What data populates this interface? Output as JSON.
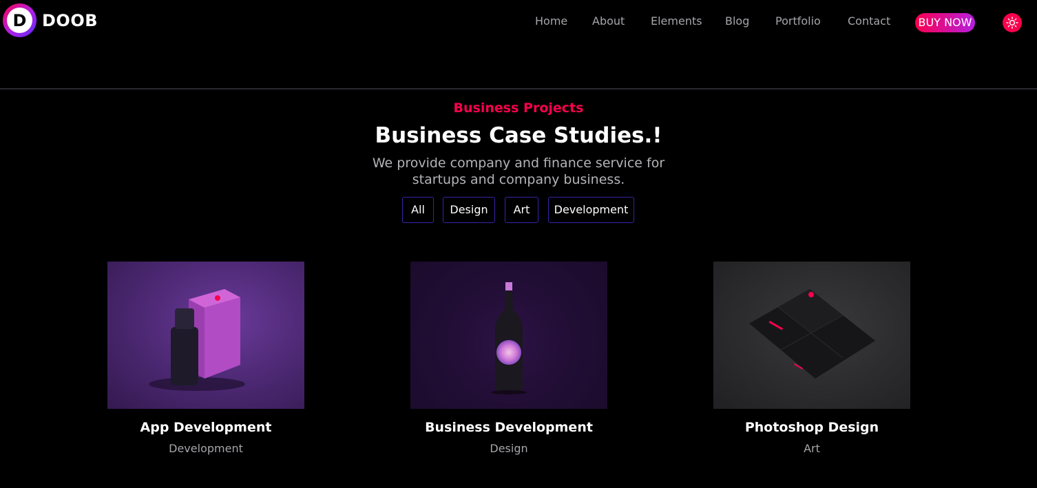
{
  "brand": {
    "logo_letter": "D",
    "name": "DOOB"
  },
  "nav": {
    "items": [
      {
        "label": "Home"
      },
      {
        "label": "About"
      },
      {
        "label": "Elements"
      },
      {
        "label": "Blog"
      },
      {
        "label": "Portfolio"
      },
      {
        "label": "Contact"
      }
    ],
    "buy_label": "BUY NOW",
    "theme_icon": "sun-icon"
  },
  "section": {
    "subtitle": "Business Projects",
    "title": "Business Case Studies.!",
    "description": "We provide company and finance service for startups and company business."
  },
  "filters": [
    {
      "label": "All"
    },
    {
      "label": "Design"
    },
    {
      "label": "Art"
    },
    {
      "label": "Development"
    }
  ],
  "projects": [
    {
      "title": "App Development",
      "category": "Development"
    },
    {
      "title": "Business Development",
      "category": "Design"
    },
    {
      "title": "Photoshop Design",
      "category": "Art"
    }
  ],
  "colors": {
    "accent": "#f9004d",
    "accent_purple": "#b61fe0",
    "filter_border": "#3a22a8",
    "background": "#000000"
  }
}
